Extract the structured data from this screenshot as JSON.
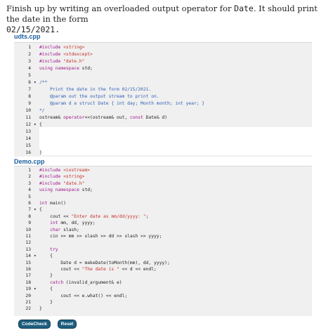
{
  "intro": {
    "text_before": "Finish up by writing an overloaded output operator for ",
    "code_word": "Date",
    "text_after": ". It should print the date in the form",
    "example": "02/15/2021."
  },
  "file1": {
    "name": "udts.cpp",
    "lines": [
      {
        "n": "1",
        "fold": "",
        "html": "<span class='kw'>#include</span> <span class='str'>&lt;string&gt;</span>"
      },
      {
        "n": "2",
        "fold": "",
        "html": "<span class='kw'>#include</span> <span class='str'>&lt;stdexcept&gt;</span>"
      },
      {
        "n": "3",
        "fold": "",
        "html": "<span class='kw'>#include</span> <span class='str'>\"date.h\"</span>"
      },
      {
        "n": "4",
        "fold": "",
        "html": "<span class='kw'>using namespace</span> std;"
      },
      {
        "n": "5",
        "fold": "",
        "html": ""
      },
      {
        "n": "6",
        "fold": "▾",
        "html": "<span class='cmt'>/**</span>"
      },
      {
        "n": "7",
        "fold": "",
        "html": "<span class='cmt'>    Print the date in the form 02/15/2021.</span>"
      },
      {
        "n": "8",
        "fold": "",
        "html": "<span class='cmt'>    @param out the output stream to print on.</span>"
      },
      {
        "n": "9",
        "fold": "",
        "html": "<span class='cmt'>    @param d a struct Date { int day; Month month; int year; }</span>"
      },
      {
        "n": "10",
        "fold": "",
        "html": "<span class='cmt'>*/</span>"
      },
      {
        "n": "11",
        "fold": "",
        "html": "ostream&amp; <span class='kw'>operator</span>&lt;&lt;(ostream&amp; out, <span class='kw'>const</span> Date&amp; d)"
      },
      {
        "n": "12",
        "fold": "▾",
        "html": "{"
      },
      {
        "n": "13",
        "fold": "",
        "html": ""
      },
      {
        "n": "14",
        "fold": "",
        "html": ""
      },
      {
        "n": "15",
        "fold": "",
        "html": ""
      },
      {
        "n": "16",
        "fold": "",
        "html": "}"
      }
    ]
  },
  "file2": {
    "name": "Demo.cpp",
    "lines": [
      {
        "n": "1",
        "fold": "",
        "html": "<span class='kw'>#include</span> <span class='str'>&lt;iostream&gt;</span>"
      },
      {
        "n": "2",
        "fold": "",
        "html": "<span class='kw'>#include</span> <span class='str'>&lt;string&gt;</span>"
      },
      {
        "n": "3",
        "fold": "",
        "html": "<span class='kw'>#include</span> <span class='str'>\"date.h\"</span>"
      },
      {
        "n": "4",
        "fold": "",
        "html": "<span class='kw'>using namespace</span> std;"
      },
      {
        "n": "5",
        "fold": "",
        "html": ""
      },
      {
        "n": "6",
        "fold": "",
        "html": "<span class='kw'>int</span> main()"
      },
      {
        "n": "7",
        "fold": "▾",
        "html": "{"
      },
      {
        "n": "8",
        "fold": "",
        "html": "    cout &lt;&lt; <span class='str'>\"Enter date as mm/dd/yyyy: \"</span>;"
      },
      {
        "n": "9",
        "fold": "",
        "html": "    <span class='kw'>int</span> mm, dd, yyyy;"
      },
      {
        "n": "10",
        "fold": "",
        "html": "    <span class='kw'>char</span> slash;"
      },
      {
        "n": "11",
        "fold": "",
        "html": "    cin &gt;&gt; mm &gt;&gt; slash &gt;&gt; dd &gt;&gt; slash &gt;&gt; yyyy;"
      },
      {
        "n": "12",
        "fold": "",
        "html": ""
      },
      {
        "n": "13",
        "fold": "",
        "html": "    <span class='kw'>try</span>"
      },
      {
        "n": "14",
        "fold": "▾",
        "html": "    {"
      },
      {
        "n": "15",
        "fold": "",
        "html": "        Date d = makeDate(toMonth(mm), dd, yyyy);"
      },
      {
        "n": "16",
        "fold": "",
        "html": "        cout &lt;&lt; <span class='str'>\"The date is \"</span> &lt;&lt; d &lt;&lt; endl;"
      },
      {
        "n": "17",
        "fold": "",
        "html": "    }"
      },
      {
        "n": "18",
        "fold": "",
        "html": "    <span class='kw'>catch</span> (invalid_argument&amp; e)"
      },
      {
        "n": "19",
        "fold": "▾",
        "html": "    {"
      },
      {
        "n": "20",
        "fold": "",
        "html": "        cout &lt;&lt; e.what() &lt;&lt; endl;"
      },
      {
        "n": "21",
        "fold": "",
        "html": "    }"
      },
      {
        "n": "22",
        "fold": "",
        "html": "}"
      }
    ]
  },
  "buttons": {
    "codecheck": "CodeCheck",
    "reset": "Reset"
  }
}
